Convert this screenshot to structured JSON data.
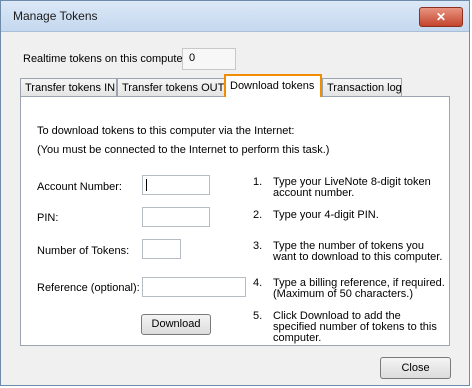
{
  "window": {
    "title": "Manage Tokens",
    "close_glyph": "✕"
  },
  "realtime": {
    "label": "Realtime tokens on this computer:",
    "value": "0"
  },
  "tabs": [
    {
      "label": "Transfer tokens IN"
    },
    {
      "label": "Transfer tokens OUT"
    },
    {
      "label": "Download tokens"
    },
    {
      "label": "Transaction log"
    }
  ],
  "panel": {
    "intro_line1": "To download tokens to this computer via the Internet:",
    "intro_line2": "(You must be connected to the Internet to perform this task.)",
    "fields": {
      "account_label": "Account Number:",
      "pin_label": "PIN:",
      "tokens_label": "Number of Tokens:",
      "reference_label": "Reference (optional):"
    },
    "download_button": "Download",
    "steps": [
      {
        "num": "1.",
        "text": "Type your LiveNote 8-digit token account number."
      },
      {
        "num": "2.",
        "text": "Type your 4-digit PIN."
      },
      {
        "num": "3.",
        "text": "Type the number of tokens you want to download to this computer."
      },
      {
        "num": "4.",
        "text": "Type a billing reference, if required. (Maximum of 50 characters.)"
      },
      {
        "num": "5.",
        "text": "Click Download to add the specified number of tokens to this computer."
      }
    ]
  },
  "footer": {
    "close_button": "Close"
  },
  "colors": {
    "active_tab_border": "#f28c00",
    "close_button": "#c4442d"
  }
}
